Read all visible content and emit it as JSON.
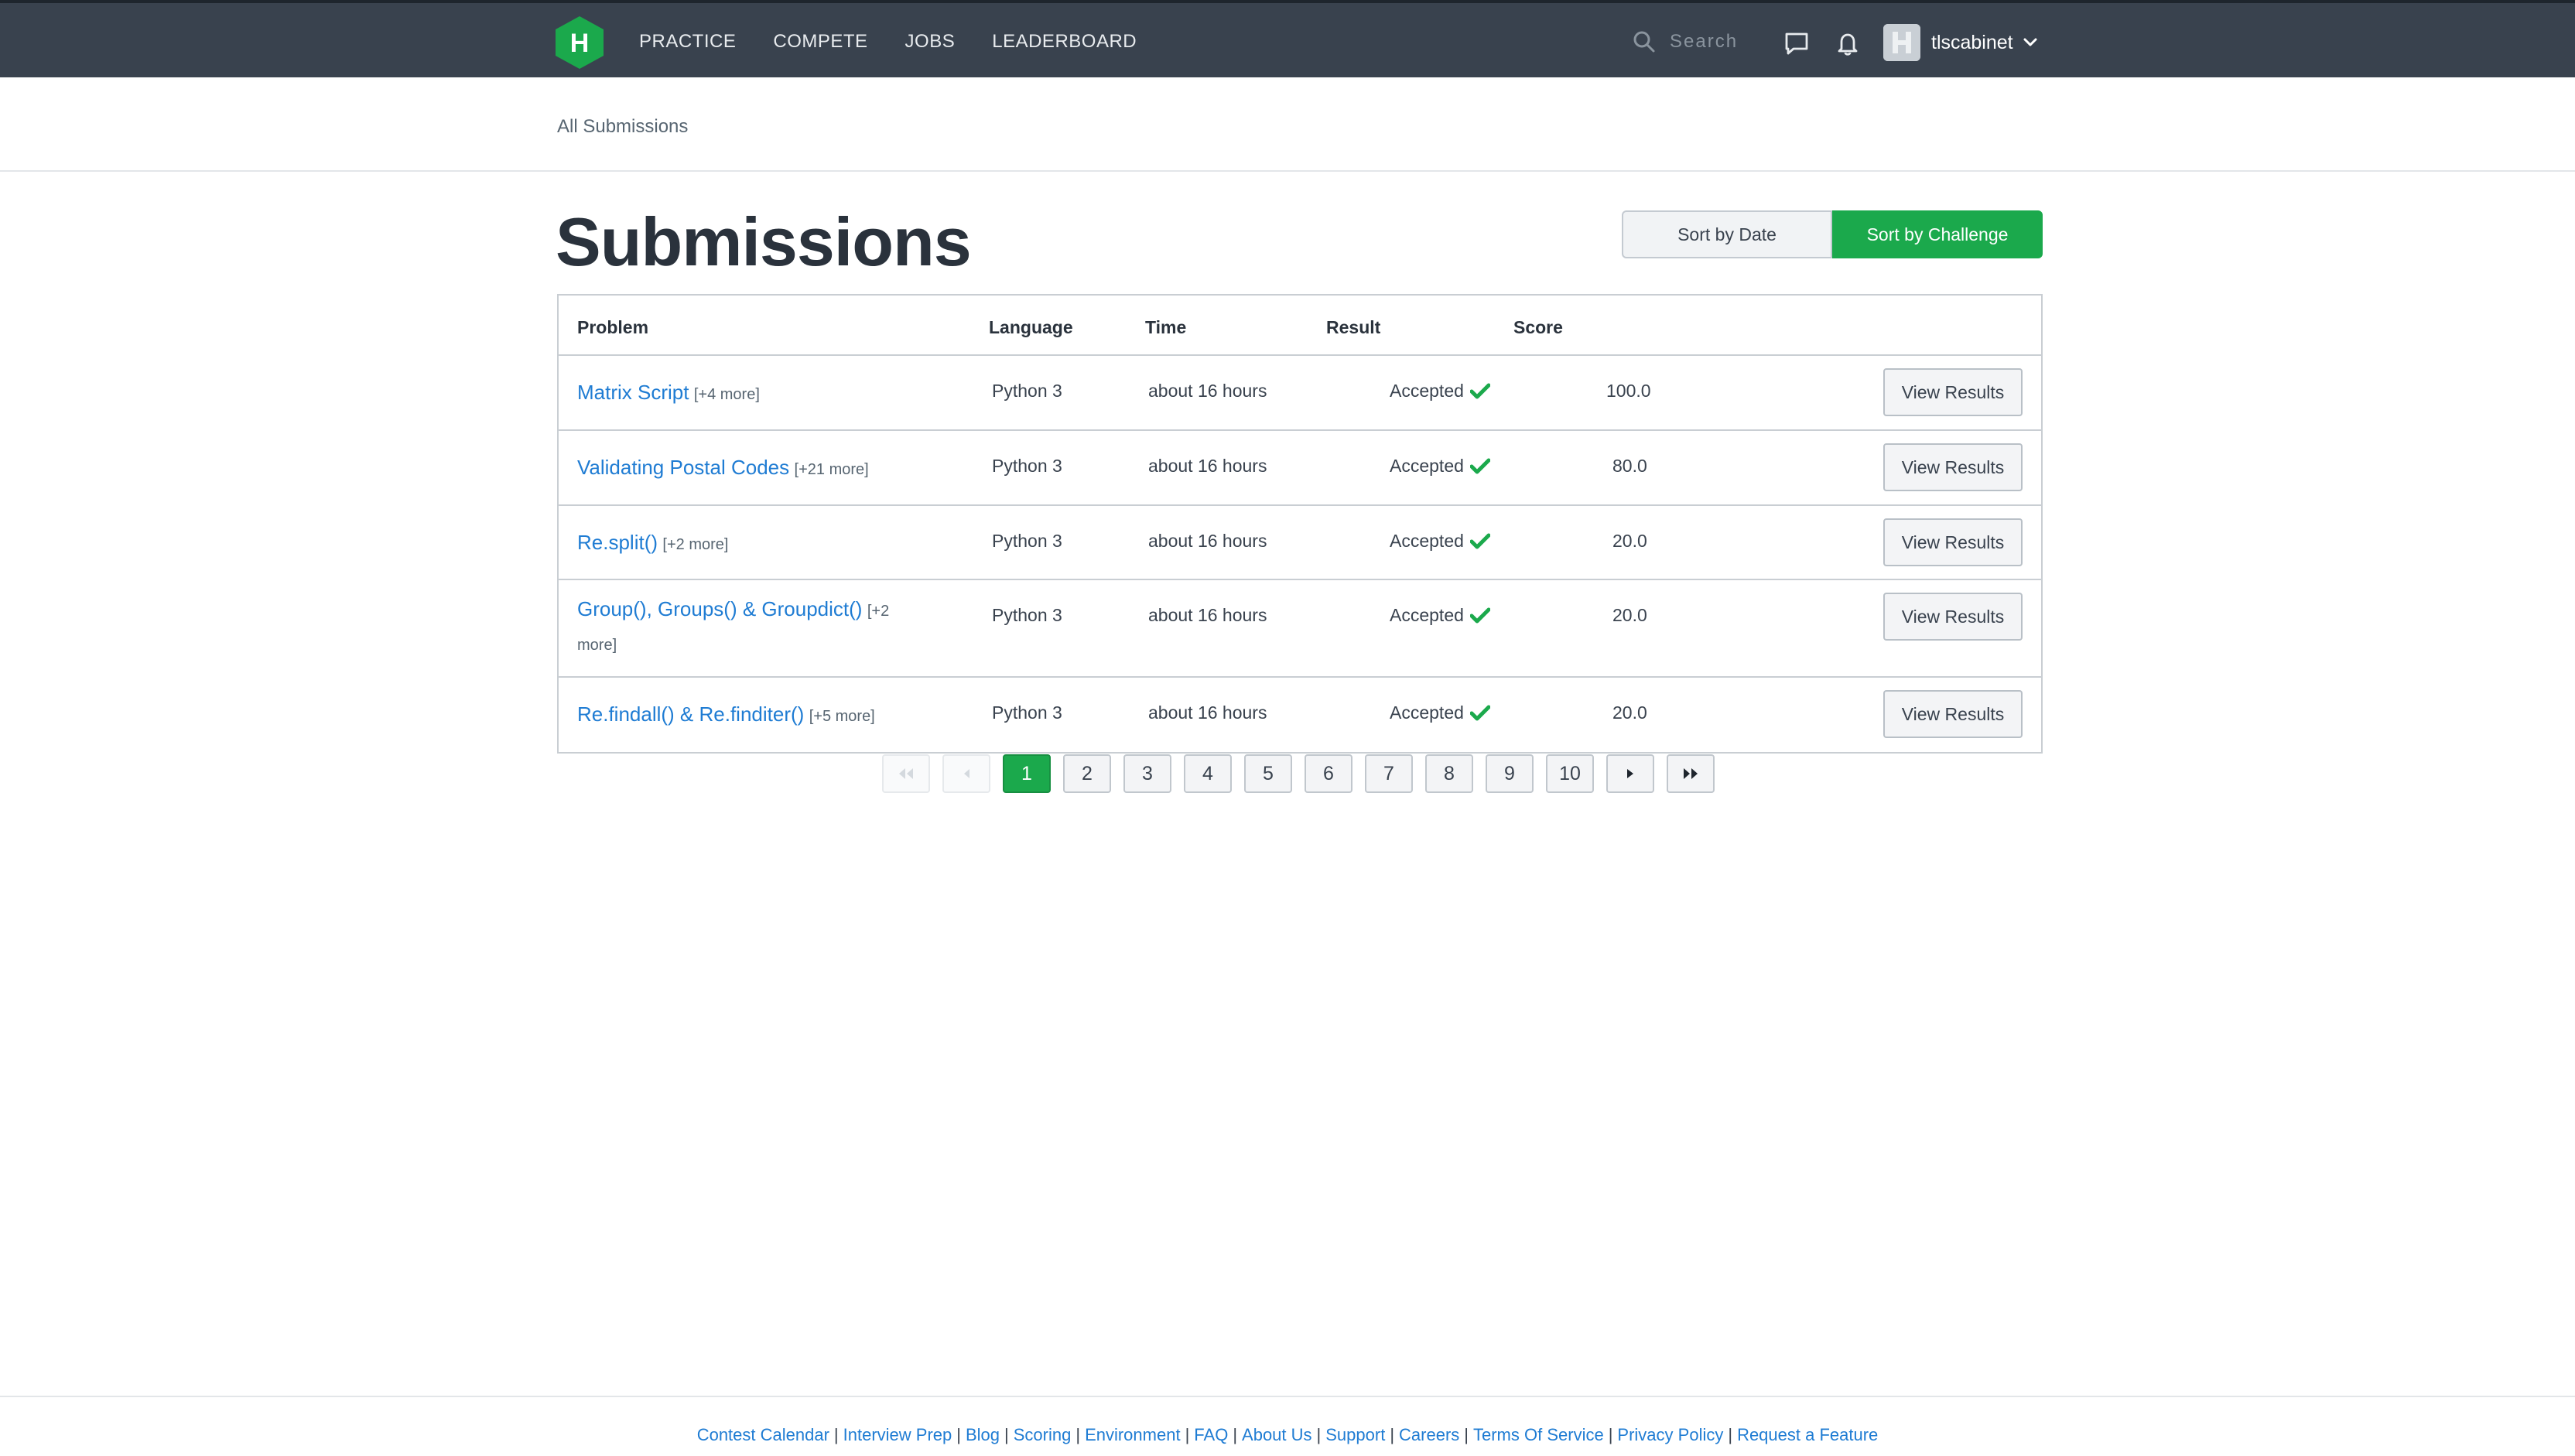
{
  "nav": {
    "links": [
      "PRACTICE",
      "COMPETE",
      "JOBS",
      "LEADERBOARD"
    ],
    "search_placeholder": "Search",
    "username": "tlscabinet",
    "logo_letter": "H"
  },
  "breadcrumb": "All Submissions",
  "page_title": "Submissions",
  "sort": {
    "by_date": "Sort by Date",
    "by_challenge": "Sort by Challenge"
  },
  "table": {
    "headers": {
      "problem": "Problem",
      "language": "Language",
      "time": "Time",
      "result": "Result",
      "score": "Score"
    },
    "rows": [
      {
        "problem": "Matrix Script",
        "more": "[+4 more]",
        "language": "Python 3",
        "time": "about 16 hours",
        "result": "Accepted",
        "score": "100.0",
        "action": "View Results"
      },
      {
        "problem": "Validating Postal Codes",
        "more": "[+21 more]",
        "language": "Python 3",
        "time": "about 16 hours",
        "result": "Accepted",
        "score": "80.0",
        "action": "View Results"
      },
      {
        "problem": "Re.split()",
        "more": "[+2 more]",
        "language": "Python 3",
        "time": "about 16 hours",
        "result": "Accepted",
        "score": "20.0",
        "action": "View Results"
      },
      {
        "problem": "Group(), Groups() & Groupdict()",
        "more": "[+2 more]",
        "language": "Python 3",
        "time": "about 16 hours",
        "result": "Accepted",
        "score": "20.0",
        "action": "View Results"
      },
      {
        "problem": "Re.findall() & Re.finditer()",
        "more": "[+5 more]",
        "language": "Python 3",
        "time": "about 16 hours",
        "result": "Accepted",
        "score": "20.0",
        "action": "View Results"
      }
    ]
  },
  "pagination": {
    "pages": [
      "1",
      "2",
      "3",
      "4",
      "5",
      "6",
      "7",
      "8",
      "9",
      "10"
    ],
    "current": "1"
  },
  "footer": {
    "links": [
      "Contest Calendar",
      "Interview Prep",
      "Blog",
      "Scoring",
      "Environment",
      "FAQ",
      "About Us",
      "Support",
      "Careers",
      "Terms Of Service",
      "Privacy Policy",
      "Request a Feature"
    ],
    "separator": "|"
  },
  "colors": {
    "nav_bg": "#39424e",
    "accent_green": "#1ba94c",
    "link_blue": "#1f7cd3"
  }
}
